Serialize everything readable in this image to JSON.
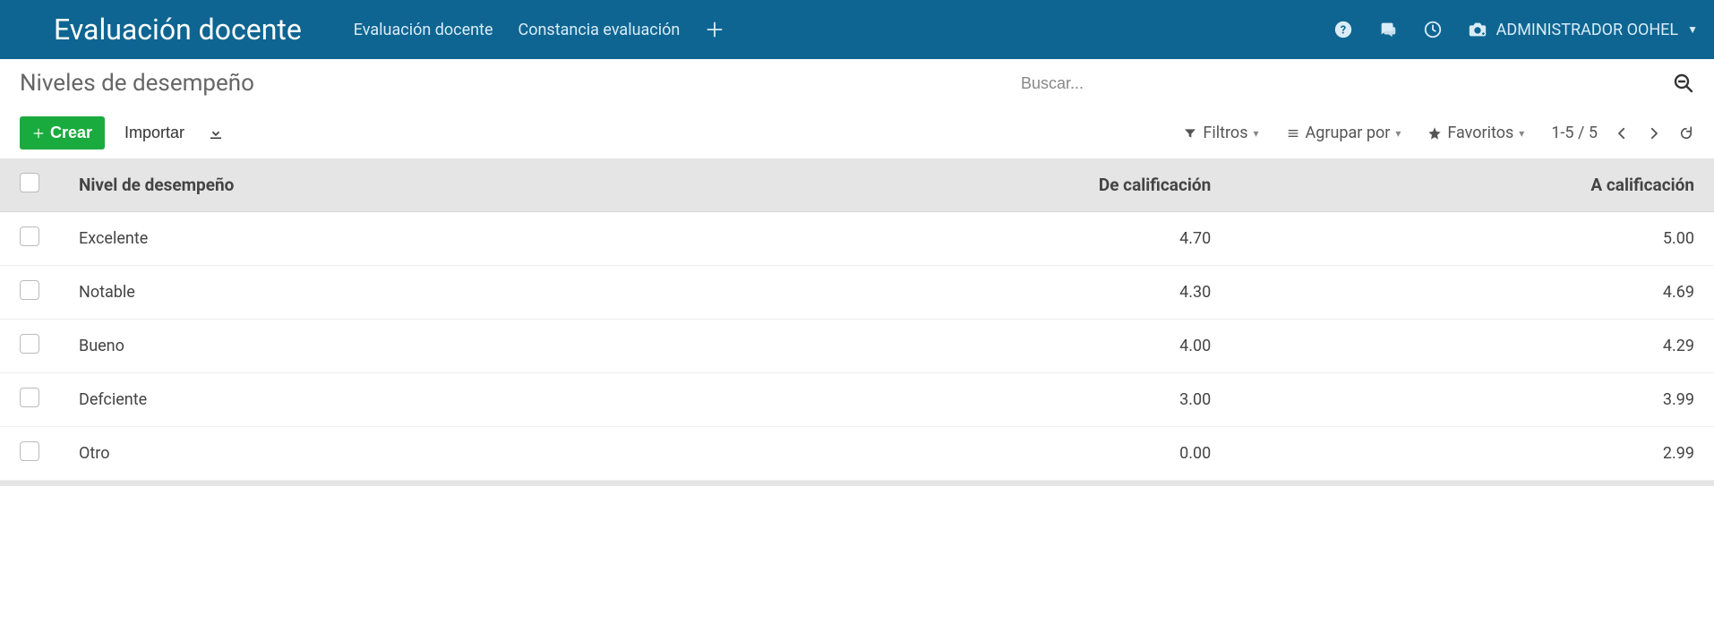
{
  "navbar": {
    "app_title": "Evaluación docente",
    "menu": [
      {
        "label": "Evaluación docente"
      },
      {
        "label": "Constancia evaluación"
      }
    ],
    "user_name": "ADMINISTRADOR OOHEL"
  },
  "control_panel": {
    "breadcrumb": "Niveles de desempeño",
    "search_placeholder": "Buscar...",
    "create_label": "Crear",
    "import_label": "Importar",
    "filters_label": "Filtros",
    "group_by_label": "Agrupar por",
    "favorites_label": "Favoritos",
    "pager_text": "1-5 / 5"
  },
  "table": {
    "columns": {
      "level": "Nivel de desempeño",
      "from_score": "De calificación",
      "to_score": "A calificación"
    },
    "rows": [
      {
        "level": "Excelente",
        "from_score": "4.70",
        "to_score": "5.00"
      },
      {
        "level": "Notable",
        "from_score": "4.30",
        "to_score": "4.69"
      },
      {
        "level": "Bueno",
        "from_score": "4.00",
        "to_score": "4.29"
      },
      {
        "level": "Defciente",
        "from_score": "3.00",
        "to_score": "3.99"
      },
      {
        "level": "Otro",
        "from_score": "0.00",
        "to_score": "2.99"
      }
    ]
  }
}
